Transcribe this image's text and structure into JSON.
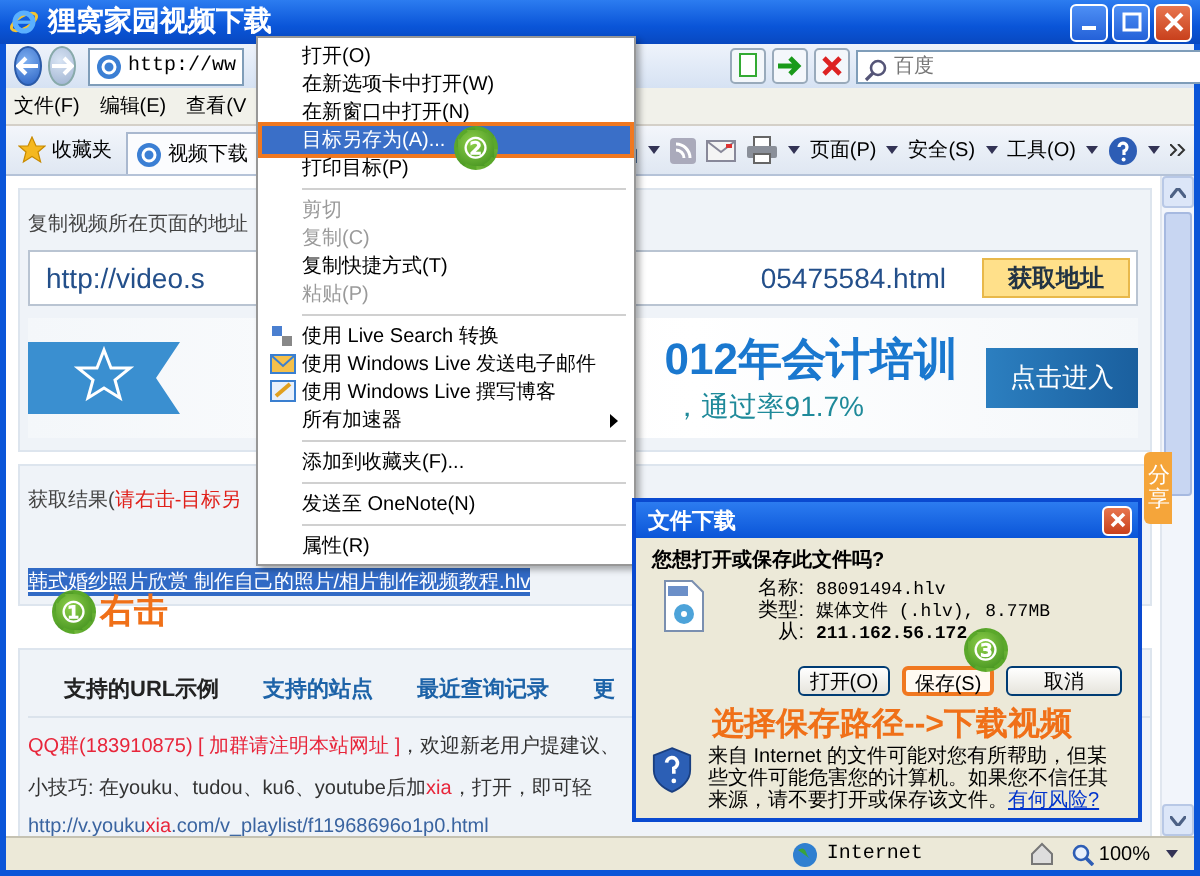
{
  "window": {
    "title": "狸窝家园视频下载"
  },
  "address_bar": {
    "value": "http://ww"
  },
  "search_field": {
    "placeholder": "百度"
  },
  "menu_bar": [
    "文件(F)",
    "编辑(E)",
    "查看(V"
  ],
  "favorites_button": "收藏夹",
  "tabs": [
    {
      "label": "视频下载",
      "selected": true
    }
  ],
  "command_bar": [
    "页面(P)",
    "安全(S)",
    "工具(O)"
  ],
  "url_section": {
    "label": "复制视频所在页面的地址",
    "url_start": "http://video.s",
    "url_end": "05475584.html",
    "button": "获取地址"
  },
  "banner": {
    "headline": "012年会计培训",
    "subline": "，通过率91.7%",
    "button": "点击进入"
  },
  "result": {
    "label": "获取结果(",
    "hint": "请右击-目标另",
    "link": "韩式婚纱照片欣赏 制作自己的照片/相片制作视频教程.hlv",
    "link_selected": true
  },
  "info_tabs": [
    {
      "label": "支持的URL示例",
      "selected": true
    },
    {
      "label": "支持的站点",
      "selected": false
    },
    {
      "label": "最近查询记录",
      "selected": false
    },
    {
      "label": "更",
      "selected": false
    }
  ],
  "info_lines": [
    {
      "kind": "text",
      "parts": [
        {
          "text": "QQ群(183910875) [ 加群请注明本站网址 ]",
          "accent": true
        },
        {
          "text": "，欢迎新老用户提建议、",
          "accent": false
        }
      ]
    },
    {
      "kind": "text",
      "parts": [
        {
          "text": "小技巧: 在youku、tudou、ku6、youtube后加",
          "accent": false
        },
        {
          "text": "xia",
          "accent": true
        },
        {
          "text": "，打开，即可轻",
          "accent": false
        }
      ]
    },
    {
      "kind": "link",
      "parts": [
        {
          "text": "http://v.youku",
          "accent": false
        },
        {
          "text": "xia",
          "accent": true
        },
        {
          "text": ".com/v_playlist/f11968696o1p0.html",
          "accent": false
        }
      ]
    }
  ],
  "share_tab": "分享",
  "status_bar": {
    "zone": "Internet",
    "zoom": "100%"
  },
  "context_menu": [
    {
      "kind": "item",
      "label": "打开(O)",
      "disabled": false,
      "selected": false,
      "submenu": false
    },
    {
      "kind": "item",
      "label": "在新选项卡中打开(W)",
      "disabled": false,
      "selected": false,
      "submenu": false
    },
    {
      "kind": "item",
      "label": "在新窗口中打开(N)",
      "disabled": false,
      "selected": false,
      "submenu": false
    },
    {
      "kind": "item",
      "label": "目标另存为(A)...",
      "disabled": false,
      "selected": true,
      "submenu": false
    },
    {
      "kind": "item",
      "label": "打印目标(P)",
      "disabled": false,
      "selected": false,
      "submenu": false
    },
    {
      "kind": "separator"
    },
    {
      "kind": "item",
      "label": "剪切",
      "disabled": true,
      "selected": false,
      "submenu": false
    },
    {
      "kind": "item",
      "label": "复制(C)",
      "disabled": true,
      "selected": false,
      "submenu": false
    },
    {
      "kind": "item",
      "label": "复制快捷方式(T)",
      "disabled": false,
      "selected": false,
      "submenu": false
    },
    {
      "kind": "item",
      "label": "粘贴(P)",
      "disabled": true,
      "selected": false,
      "submenu": false
    },
    {
      "kind": "separator"
    },
    {
      "kind": "item",
      "label": "使用 Live Search 转换",
      "disabled": false,
      "selected": false,
      "submenu": false
    },
    {
      "kind": "item",
      "label": "使用 Windows Live 发送电子邮件",
      "disabled": false,
      "selected": false,
      "submenu": false
    },
    {
      "kind": "item",
      "label": "使用 Windows Live 撰写博客",
      "disabled": false,
      "selected": false,
      "submenu": false
    },
    {
      "kind": "item",
      "label": "所有加速器",
      "disabled": false,
      "selected": false,
      "submenu": true
    },
    {
      "kind": "separator"
    },
    {
      "kind": "item",
      "label": "添加到收藏夹(F)...",
      "disabled": false,
      "selected": false,
      "submenu": false
    },
    {
      "kind": "separator"
    },
    {
      "kind": "item",
      "label": "发送至 OneNote(N)",
      "disabled": false,
      "selected": false,
      "submenu": false
    },
    {
      "kind": "separator"
    },
    {
      "kind": "item",
      "label": "属性(R)",
      "disabled": false,
      "selected": false,
      "submenu": false
    }
  ],
  "dialog": {
    "title": "文件下载",
    "question": "您想打开或保存此文件吗?",
    "fields": [
      {
        "label": "名称:",
        "value": "88091494.hlv"
      },
      {
        "label": "类型:",
        "value": "媒体文件 (.hlv), 8.77MB"
      },
      {
        "label": "从:",
        "value": "211.162.56.172"
      }
    ],
    "buttons": [
      {
        "label": "打开(O)",
        "selected": false
      },
      {
        "label": "保存(S)",
        "selected": true
      },
      {
        "label": "取消",
        "selected": false
      }
    ],
    "warning": "来自 Internet 的文件可能对您有所帮助，但某些文件可能危害您的计算机。如果您不信任其来源，请不要打开或保存该文件。",
    "risk_link": "有何风险?"
  },
  "steps": [
    {
      "number": "①",
      "caption": "右击"
    },
    {
      "number": "②"
    },
    {
      "number": "③"
    }
  ],
  "callout": "选择保存路径-->下载视频"
}
